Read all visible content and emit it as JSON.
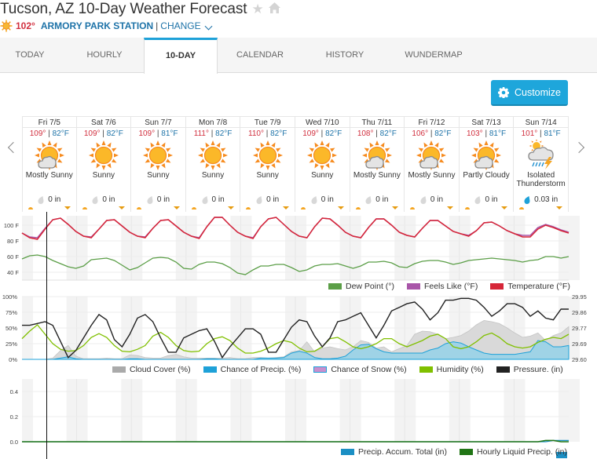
{
  "header": {
    "title": "Tucson, AZ 10-Day Weather Forecast",
    "favorite_icon": "star-icon",
    "home_icon": "home-icon",
    "current_temp": "102°",
    "current_icon": "sun-icon",
    "station": "ARMORY PARK STATION",
    "separator": "|",
    "change_label": "CHANGE"
  },
  "tabs": [
    {
      "label": "TODAY",
      "active": false
    },
    {
      "label": "HOURLY",
      "active": false
    },
    {
      "label": "10-DAY",
      "active": true
    },
    {
      "label": "CALENDAR",
      "active": false
    },
    {
      "label": "HISTORY",
      "active": false
    },
    {
      "label": "WUNDERMAP",
      "active": false
    }
  ],
  "customize_label": "Customize",
  "days": [
    {
      "name": "Fri 7/5",
      "hi": "109°",
      "lo": "82°F",
      "condition": "Mostly Sunny",
      "icon": "mostly-sunny",
      "precip": "0 in"
    },
    {
      "name": "Sat 7/6",
      "hi": "109°",
      "lo": "82°F",
      "condition": "Sunny",
      "icon": "sunny",
      "precip": "0 in"
    },
    {
      "name": "Sun 7/7",
      "hi": "109°",
      "lo": "81°F",
      "condition": "Sunny",
      "icon": "sunny",
      "precip": "0 in"
    },
    {
      "name": "Mon 7/8",
      "hi": "111°",
      "lo": "82°F",
      "condition": "Sunny",
      "icon": "sunny",
      "precip": "0 in"
    },
    {
      "name": "Tue 7/9",
      "hi": "110°",
      "lo": "82°F",
      "condition": "Sunny",
      "icon": "sunny",
      "precip": "0 in"
    },
    {
      "name": "Wed 7/10",
      "hi": "109°",
      "lo": "82°F",
      "condition": "Sunny",
      "icon": "sunny",
      "precip": "0 in"
    },
    {
      "name": "Thu 7/11",
      "hi": "108°",
      "lo": "82°F",
      "condition": "Mostly Sunny",
      "icon": "mostly-sunny",
      "precip": "0 in"
    },
    {
      "name": "Fri 7/12",
      "hi": "106°",
      "lo": "82°F",
      "condition": "Mostly Sunny",
      "icon": "mostly-sunny",
      "precip": "0 in"
    },
    {
      "name": "Sat 7/13",
      "hi": "103°",
      "lo": "81°F",
      "condition": "Partly Cloudy",
      "icon": "partly-cloudy",
      "precip": "0 in"
    },
    {
      "name": "Sun 7/14",
      "hi": "101°",
      "lo": "81°F",
      "condition": "Isolated Thunderstorm",
      "icon": "thunderstorm",
      "precip": "0.03 in"
    }
  ],
  "colors": {
    "temperature": "#d62638",
    "feels_like": "#a855a8",
    "dew_point": "#5b9e47",
    "cloud_cover": "#aaaaaa",
    "chance_precip": "#1ea1d8",
    "chance_snow": "#c98fce",
    "humidity": "#80c000",
    "pressure": "#222222",
    "precip_accum": "#1b8fc4",
    "hourly_liquid": "#207515",
    "accent": "#1ea6db"
  },
  "chart_data": [
    {
      "type": "line",
      "title": "Temperature",
      "ylabels": [
        "100 F",
        "80 F",
        "60 F",
        "40 F"
      ],
      "ylim": [
        30,
        112
      ],
      "legend": [
        "Dew Point (°)",
        "Feels Like (°F)",
        "Temperature (°F)"
      ],
      "series": [
        {
          "name": "Temperature (°F)",
          "values": [
            90,
            84,
            82,
            95,
            107,
            109,
            101,
            92,
            86,
            84,
            95,
            106,
            107,
            99,
            91,
            86,
            84,
            96,
            106,
            107,
            99,
            91,
            86,
            83,
            98,
            110,
            110,
            100,
            91,
            86,
            83,
            98,
            108,
            110,
            101,
            92,
            86,
            84,
            98,
            109,
            108,
            100,
            91,
            86,
            84,
            97,
            108,
            108,
            100,
            91,
            87,
            85,
            96,
            106,
            106,
            99,
            92,
            89,
            86,
            93,
            103,
            104,
            99,
            93,
            89,
            85,
            85,
            95,
            100,
            97,
            93,
            90
          ]
        },
        {
          "name": "Feels Like (°F)",
          "values": [
            90,
            85,
            84,
            96,
            107,
            109,
            101,
            92,
            86,
            85,
            95,
            106,
            107,
            99,
            91,
            86,
            85,
            96,
            106,
            107,
            99,
            91,
            86,
            84,
            98,
            110,
            110,
            100,
            91,
            86,
            84,
            98,
            108,
            110,
            101,
            92,
            86,
            84,
            98,
            109,
            108,
            100,
            91,
            86,
            84,
            97,
            108,
            108,
            100,
            91,
            87,
            85,
            96,
            106,
            106,
            99,
            92,
            89,
            87,
            93,
            103,
            104,
            99,
            93,
            89,
            87,
            87,
            97,
            101,
            98,
            94,
            91
          ]
        },
        {
          "name": "Dew Point (°)",
          "values": [
            57,
            61,
            62,
            60,
            55,
            51,
            47,
            45,
            48,
            56,
            57,
            58,
            55,
            49,
            43,
            46,
            52,
            58,
            59,
            58,
            53,
            45,
            44,
            50,
            53,
            53,
            51,
            46,
            39,
            37,
            43,
            48,
            48,
            50,
            50,
            46,
            41,
            43,
            48,
            50,
            50,
            51,
            48,
            45,
            48,
            53,
            53,
            54,
            52,
            47,
            46,
            51,
            54,
            55,
            55,
            53,
            50,
            52,
            55,
            56,
            57,
            58,
            57,
            56,
            55,
            53,
            55,
            56,
            60,
            60,
            58,
            60
          ]
        }
      ]
    },
    {
      "type": "area",
      "title": "Cloud / Precip / Humidity / Pressure",
      "ylabels_left": [
        "100%",
        "75%",
        "50%",
        "25%",
        "0%"
      ],
      "ylabels_right": [
        "29.95",
        "29.86",
        "29.77",
        "29.69",
        "29.60"
      ],
      "ylim_left": [
        0,
        100
      ],
      "ylim_right": [
        29.6,
        29.95
      ],
      "legend": [
        "Cloud Cover (%)",
        "Chance of Precip. (%)",
        "Chance of Snow (%)",
        "Humidity (%)",
        "Pressure. (in)"
      ],
      "series": [
        {
          "name": "Pressure. (in)",
          "values": [
            29.79,
            29.79,
            29.8,
            29.81,
            29.79,
            29.7,
            29.61,
            29.65,
            29.72,
            29.79,
            29.85,
            29.82,
            29.71,
            29.67,
            29.74,
            29.83,
            29.85,
            29.81,
            29.72,
            29.64,
            29.64,
            29.72,
            29.74,
            29.76,
            29.77,
            29.7,
            29.61,
            29.67,
            29.72,
            29.77,
            29.77,
            29.74,
            29.64,
            29.64,
            29.71,
            29.78,
            29.82,
            29.81,
            29.73,
            29.67,
            29.72,
            29.81,
            29.82,
            29.84,
            29.86,
            29.79,
            29.72,
            29.79,
            29.87,
            29.89,
            29.91,
            29.92,
            29.88,
            29.82,
            29.86,
            29.93,
            29.93,
            29.94,
            29.94,
            29.93,
            29.89,
            29.84,
            29.87,
            29.91,
            29.91,
            29.89,
            29.84,
            29.87,
            29.83,
            29.82,
            29.88,
            29.88
          ]
        },
        {
          "name": "Humidity (%)",
          "values": [
            33,
            45,
            55,
            40,
            25,
            16,
            13,
            14,
            22,
            35,
            41,
            35,
            22,
            13,
            12,
            16,
            22,
            37,
            43,
            35,
            22,
            14,
            12,
            13,
            25,
            33,
            36,
            30,
            18,
            10,
            10,
            13,
            18,
            25,
            30,
            27,
            18,
            12,
            13,
            20,
            33,
            35,
            28,
            20,
            17,
            20,
            25,
            33,
            33,
            25,
            20,
            25,
            30,
            37,
            40,
            33,
            20,
            17,
            20,
            28,
            38,
            42,
            35,
            25,
            20,
            18,
            20,
            27,
            32,
            35,
            33,
            40
          ]
        },
        {
          "name": "Cloud Cover (%)",
          "values": [
            0,
            0,
            0,
            0,
            2,
            14,
            22,
            5,
            1,
            1,
            1,
            2,
            1,
            1,
            7,
            6,
            3,
            2,
            2,
            6,
            8,
            4,
            2,
            2,
            2,
            2,
            2,
            3,
            1,
            1,
            3,
            3,
            2,
            3,
            4,
            12,
            14,
            28,
            12,
            18,
            20,
            17,
            15,
            20,
            30,
            27,
            18,
            20,
            12,
            17,
            22,
            40,
            45,
            44,
            40,
            33,
            35,
            38,
            45,
            55,
            62,
            60,
            57,
            50,
            42,
            35,
            37,
            42,
            30,
            38,
            42,
            52
          ]
        },
        {
          "name": "Chance of Precip. (%)",
          "values": [
            0,
            0,
            0,
            0,
            0,
            2,
            4,
            1,
            0,
            0,
            0,
            0,
            0,
            0,
            1,
            1,
            0,
            0,
            0,
            0,
            0,
            0,
            0,
            0,
            1,
            1,
            0,
            0,
            0,
            0,
            0,
            2,
            2,
            2,
            3,
            10,
            13,
            10,
            3,
            1,
            1,
            2,
            5,
            15,
            23,
            24,
            17,
            12,
            10,
            10,
            10,
            10,
            10,
            15,
            18,
            25,
            28,
            26,
            20,
            15,
            10,
            8,
            8,
            8,
            8,
            10,
            12,
            30,
            28,
            20,
            20,
            22
          ]
        },
        {
          "name": "Chance of Snow (%)",
          "values": []
        }
      ]
    },
    {
      "type": "line",
      "title": "Precipitation",
      "ylabels": [
        "0.4",
        "0.2",
        "0.0"
      ],
      "ylim": [
        0,
        0.5
      ],
      "legend": [
        "Precip. Accum. Total (in)",
        "Hourly Liquid Precip. (in)"
      ],
      "series": [
        {
          "name": "Precip. Accum. Total (in)",
          "values": [
            0,
            0,
            0,
            0,
            0,
            0,
            0,
            0,
            0,
            0,
            0,
            0,
            0,
            0,
            0,
            0,
            0,
            0,
            0,
            0,
            0,
            0,
            0,
            0,
            0,
            0,
            0,
            0,
            0,
            0,
            0,
            0,
            0,
            0,
            0,
            0,
            0,
            0,
            0,
            0,
            0,
            0,
            0,
            0,
            0,
            0,
            0,
            0,
            0,
            0,
            0,
            0,
            0,
            0,
            0,
            0,
            0,
            0,
            0,
            0,
            0,
            0,
            0,
            0,
            0,
            0,
            0,
            0,
            0,
            0.01,
            0.01,
            0.01
          ]
        },
        {
          "name": "Hourly Liquid Precip. (in)",
          "values": [
            0,
            0,
            0,
            0,
            0,
            0,
            0,
            0,
            0,
            0,
            0,
            0,
            0,
            0,
            0,
            0,
            0,
            0,
            0,
            0,
            0,
            0,
            0,
            0,
            0,
            0,
            0,
            0,
            0,
            0,
            0,
            0,
            0,
            0,
            0,
            0,
            0,
            0,
            0,
            0,
            0,
            0,
            0,
            0,
            0,
            0,
            0,
            0,
            0,
            0,
            0,
            0,
            0,
            0,
            0,
            0,
            0,
            0,
            0,
            0,
            0,
            0,
            0,
            0,
            0,
            0,
            0,
            0,
            0.01,
            0.01,
            0,
            0
          ]
        }
      ]
    }
  ]
}
